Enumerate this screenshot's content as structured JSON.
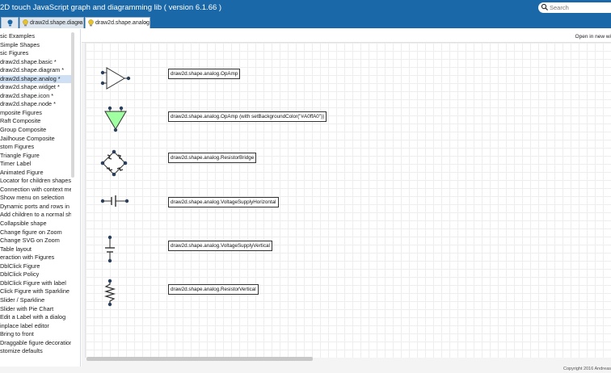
{
  "header": {
    "app_title": "2D touch JavaScript graph and diagramming lib ( version 6.1.66 )",
    "search_placeholder": "Search"
  },
  "tabs": [
    {
      "label": ""
    },
    {
      "label": "draw2d.shape.diagra",
      "close": "✕"
    },
    {
      "label": "draw2d.shape.analog",
      "close": "✕"
    }
  ],
  "sidebar": {
    "items": [
      "sic Examples",
      "Simple Shapes",
      "sic Figures",
      "draw2d.shape.basic *",
      "draw2d.shape.diagram *",
      "draw2d.shape.analog *",
      "draw2d.shape.widget *",
      "draw2d.shape.icon *",
      "draw2d.shape.node *",
      "mposite Figures",
      "Raft Composite",
      "Group Composite",
      "Jailhouse Composite",
      "stom Figures",
      "Triangle Figure",
      "Timer Label",
      "Animated Figure",
      "Locator for children shapes",
      "Connection with context mer",
      "Show menu on selection",
      "Dynamic ports and rows in a",
      "Add children to a normal sha",
      "Collapsible shape",
      "Change figure on Zoom",
      "Change SVG on Zoom",
      "Table layout",
      "eraction with Figures",
      "DblClick Figure",
      "DblClick Policy",
      "DblClick Figure with label",
      "Click Figure with Sparkline",
      "Slider / Sparkline",
      "Slider with Pie Chart",
      "Edit a Label with a dialog",
      "inplace label editor",
      "Bring to front",
      "Draggable figure decoration",
      "stomize defaults"
    ],
    "selected_index": 5
  },
  "main": {
    "open_link": "Open in new wi",
    "labels": [
      "draw2d.shape.analog.OpAmp",
      "draw2d.shape.analog.OpAmp (with setBackgroundColor(\"#A0ffA0\"))",
      "draw2d.shape.analog.ResistorBridge",
      "draw2d.shape.analog.VoltageSupplyHorizontal",
      "draw2d.shape.analog.VoltageSupplyVertical",
      "draw2d.shape.analog.ResistorVertical"
    ]
  },
  "footer": {
    "copyright": "Copyright 2016 Andreas"
  },
  "colors": {
    "topbar": "#1b68a8",
    "opamp_fill": "#A0ffA0",
    "selected_item": "#cfe0f4"
  }
}
